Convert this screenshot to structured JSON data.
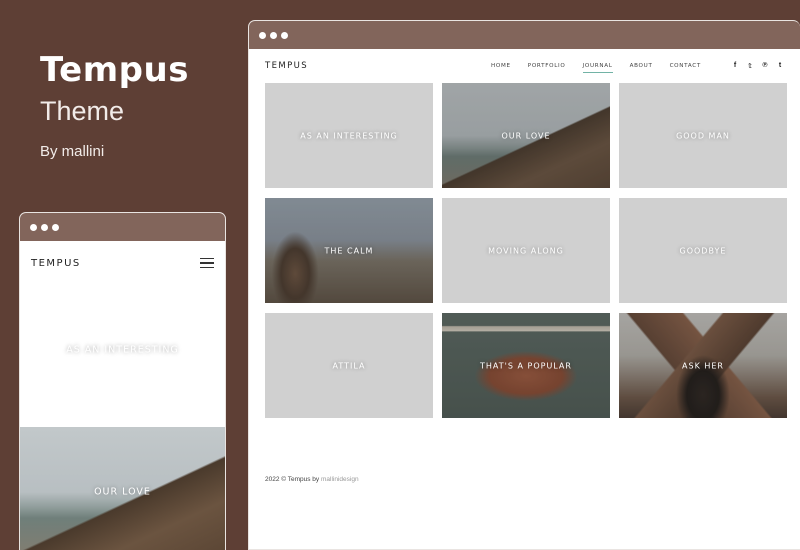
{
  "promo": {
    "title": "Tempus",
    "subtitle": "Theme",
    "byline": "By mallini"
  },
  "desktop": {
    "brand": "TEMPUS",
    "menu": [
      {
        "label": "HOME",
        "active": false
      },
      {
        "label": "PORTFOLIO",
        "active": false
      },
      {
        "label": "JOURNAL",
        "active": true
      },
      {
        "label": "ABOUT",
        "active": false
      },
      {
        "label": "CONTACT",
        "active": false
      }
    ],
    "social": [
      {
        "icon": "facebook-icon",
        "glyph": "f"
      },
      {
        "icon": "twitter-icon",
        "glyph": "𝕥"
      },
      {
        "icon": "pinterest-icon",
        "glyph": "℗"
      },
      {
        "icon": "tumblr-icon",
        "glyph": "t"
      }
    ],
    "tiles": [
      "AS AN INTERESTING",
      "OUR LOVE",
      "GOOD MAN",
      "THE CALM",
      "MOVING ALONG",
      "GOODBYE",
      "ATTILA",
      "THAT'S A POPULAR",
      "ASK HER"
    ],
    "footer": {
      "prefix": "2022 © Tempus by ",
      "author": "mallinidesign"
    }
  },
  "mobile": {
    "brand": "TEMPUS",
    "tiles": [
      "AS AN INTERESTING",
      "OUR LOVE"
    ]
  }
}
